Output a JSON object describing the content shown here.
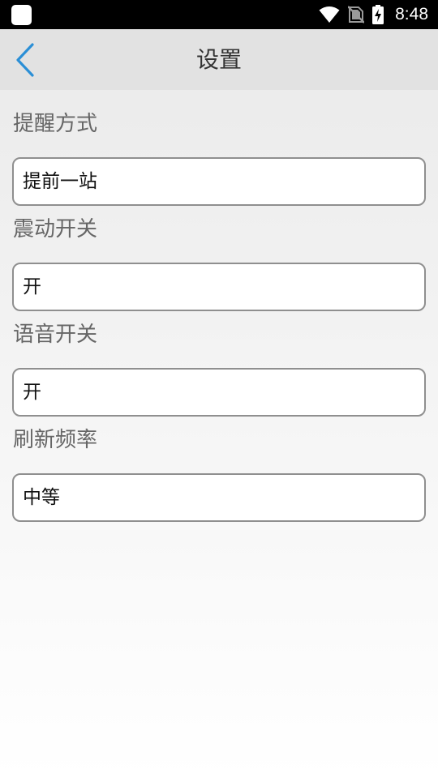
{
  "status_bar": {
    "time": "8:48",
    "icons": [
      "app-notification-icon",
      "wifi-icon",
      "no-sim-icon",
      "battery-charging-icon"
    ]
  },
  "header": {
    "title": "设置",
    "back_icon": "chevron-left-icon",
    "accent_color": "#2b8fd6"
  },
  "settings": [
    {
      "label": "提醒方式",
      "value": "提前一站"
    },
    {
      "label": "震动开关",
      "value": "开"
    },
    {
      "label": "语音开关",
      "value": "开"
    },
    {
      "label": "刷新频率",
      "value": "中等"
    }
  ]
}
